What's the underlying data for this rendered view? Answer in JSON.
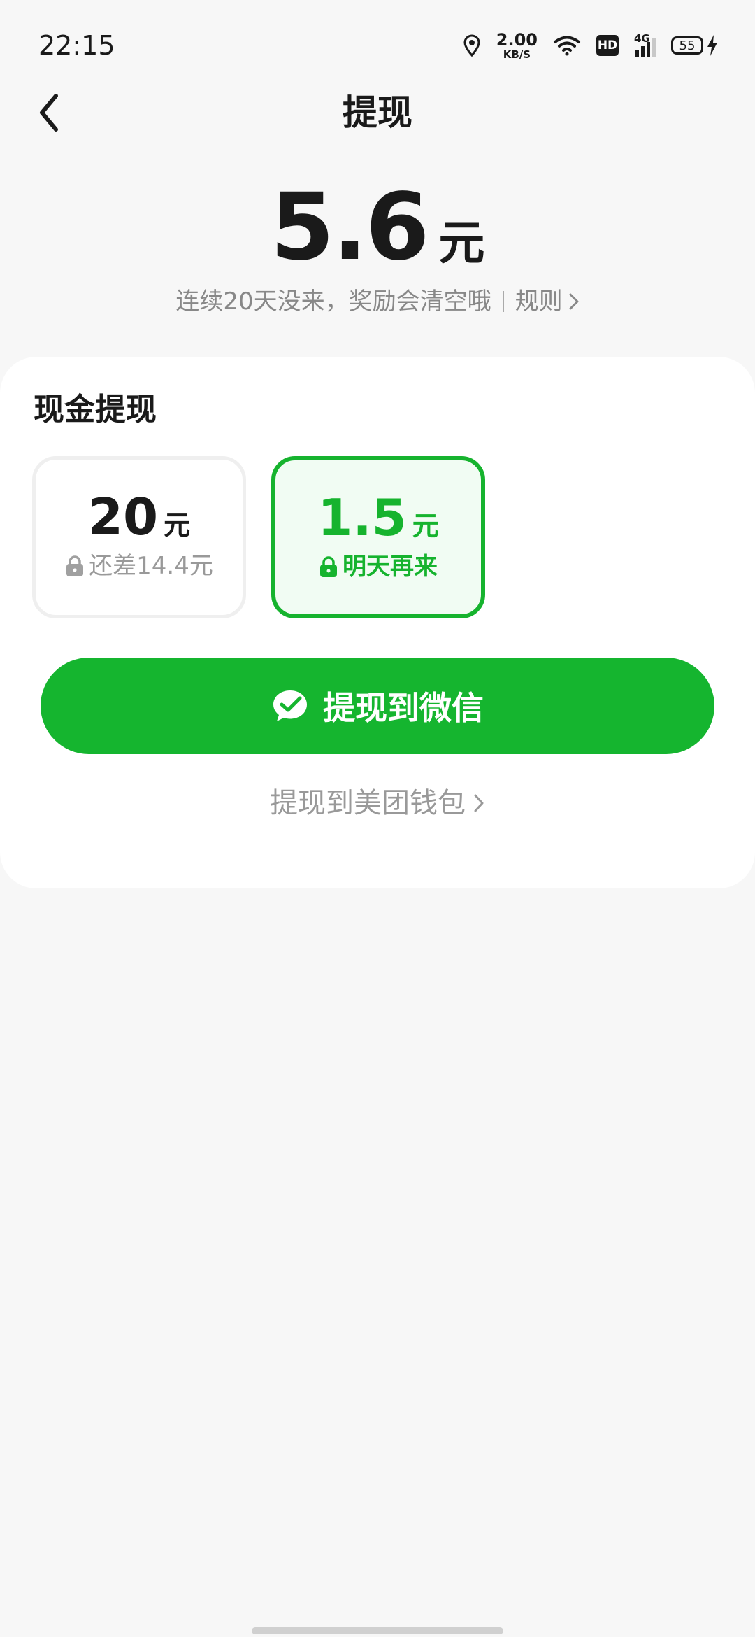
{
  "status_bar": {
    "time": "22:15",
    "net_speed_value": "2.00",
    "net_speed_unit": "KB/S",
    "hd_label": "HD",
    "network_type": "4G",
    "battery_level": "55",
    "icons": [
      "location-icon",
      "wifi-icon",
      "hd-icon",
      "cellular-signal-icon",
      "battery-icon",
      "charging-bolt-icon"
    ]
  },
  "header": {
    "title": "提现",
    "back_icon": "chevron-left-icon"
  },
  "balance": {
    "amount": "5.6",
    "unit": "元",
    "notice": "连续20天没来，奖励会清空哦",
    "rules_label": "规则"
  },
  "cash_withdraw": {
    "title": "现金提现",
    "options": [
      {
        "value": "20",
        "unit": "元",
        "sub": "还差14.4元",
        "selected": false
      },
      {
        "value": "1.5",
        "unit": "元",
        "sub": "明天再来",
        "selected": true
      }
    ],
    "wechat_button_label": "提现到微信",
    "wallet_link_label": "提现到美团钱包"
  },
  "colors": {
    "accent_green": "#15b52f",
    "selected_bg": "#f1fcf3",
    "muted_text": "#999999"
  }
}
